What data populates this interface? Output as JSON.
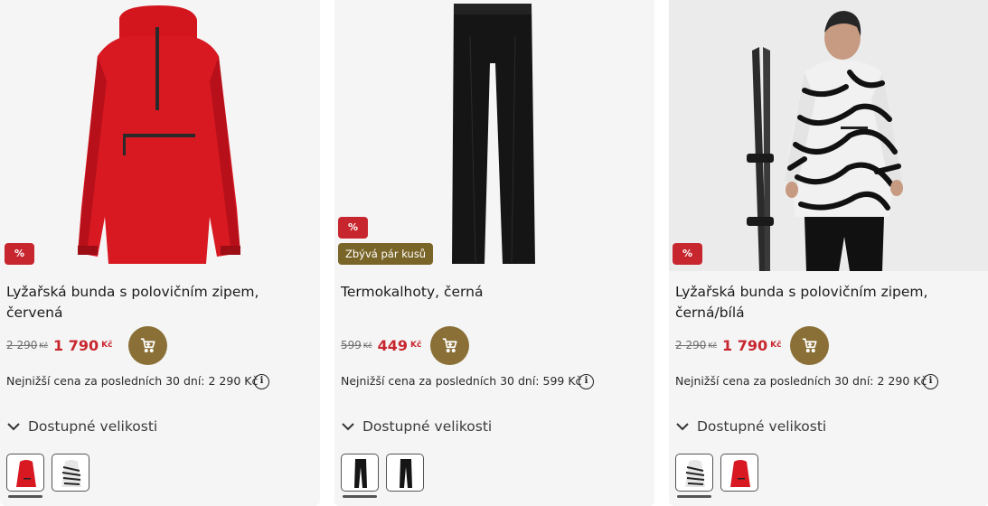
{
  "products": [
    {
      "title": "Lyžařská bunda s polovičním zipem, červená",
      "discount_badge": "%",
      "old_price": "2 290",
      "old_currency": "Kč",
      "new_price": "1 790",
      "new_currency": "Kč",
      "lowest_price_note": "Nejnižší cena za posledních 30 dní: 2 290 Kč",
      "sizes_label": "Dostupné velikosti",
      "image": "red-ski-jacket",
      "variants": [
        "red-jacket",
        "zebra-jacket"
      ]
    },
    {
      "title": "Termokalhoty, černá",
      "discount_badge": "%",
      "stock_badge": "Zbývá pár kusů",
      "old_price": "599",
      "old_currency": "Kč",
      "new_price": "449",
      "new_currency": "Kč",
      "lowest_price_note": "Nejnižší cena za posledních 30 dní: 599 Kč",
      "sizes_label": "Dostupné velikosti",
      "image": "black-thermo-pants",
      "variants": [
        "black-pants",
        "black-pants"
      ]
    },
    {
      "title": "Lyžařská bunda s polovičním zipem, černá/bílá",
      "discount_badge": "%",
      "old_price": "2 290",
      "old_currency": "Kč",
      "new_price": "1 790",
      "new_currency": "Kč",
      "lowest_price_note": "Nejnižší cena za posledních 30 dní: 2 290 Kč",
      "sizes_label": "Dostupné velikosti",
      "image": "model-zebra-jacket-with-skis",
      "variants": [
        "zebra-jacket",
        "red-jacket"
      ]
    }
  ],
  "colors": {
    "discount": "#c8262f",
    "cart_button": "#8a7037",
    "stock_badge": "#7a6528",
    "card_bg": "#f5f5f5"
  },
  "icons": {
    "cart": "cart-icon",
    "info": "info-icon",
    "chevron": "chevron-down-icon"
  },
  "info_glyph": "i"
}
